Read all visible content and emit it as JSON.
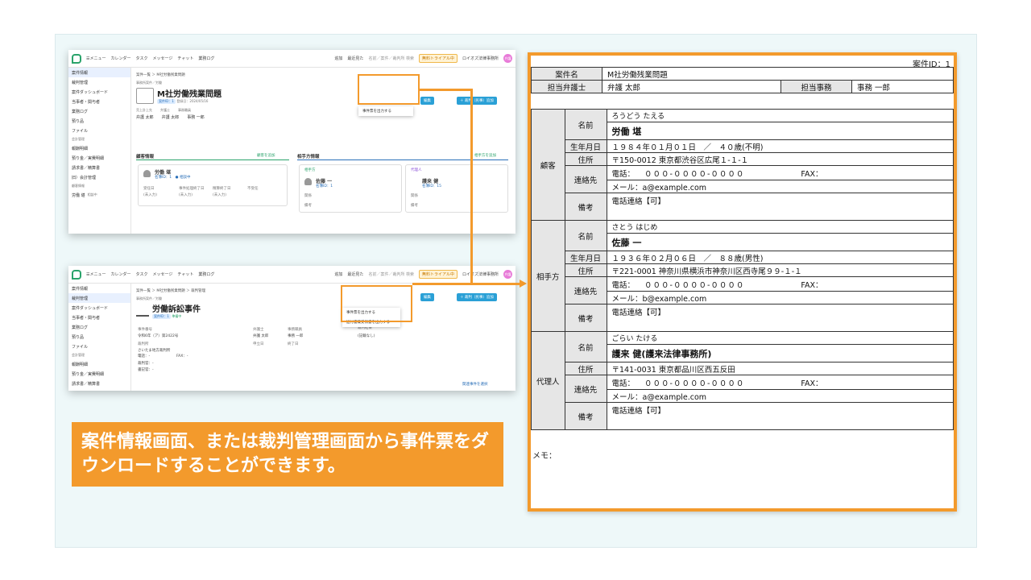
{
  "colors": {
    "accent": "#f39a2c",
    "green": "#2aa36b",
    "blue": "#2aa0d6"
  },
  "app": {
    "menu": "☰メニュー",
    "calendar": "カレンダー",
    "task": "タスク",
    "message": "メッセージ",
    "chat": "チャット",
    "worklog": "業務ログ",
    "add": "追加",
    "recent": "最近見た",
    "search_placeholder": "名前／案件／裁判所 検索",
    "trial": "無料トライアル中",
    "firm": "ロイオズ法律事務所",
    "avatar": "弁護"
  },
  "sidebar1": [
    {
      "label": "案件情報"
    },
    {
      "label": "裁判管理"
    },
    {
      "label": "案件ダッシュボード"
    },
    {
      "label": "当事者・関与者"
    },
    {
      "label": "業務ログ"
    },
    {
      "label": "預り品"
    },
    {
      "label": "ファイル"
    }
  ],
  "sidebar1_accounting": {
    "section": "会計管理",
    "items": [
      "報酬明細",
      "預り金／実費明細",
      "請求書／精算書",
      "旧）会計管理"
    ]
  },
  "sidebar1_client": {
    "section": "顧客情報",
    "name": "労働 堪",
    "status": "相談中"
  },
  "shot1": {
    "crumb": "案件一覧 ＞ M社労働残業問題",
    "category": "事務所案件／労働",
    "title": "M社労働残業問題",
    "case_id": "案件ID：1",
    "created": "登録日：2024/05/16",
    "roles": [
      "売上計上先",
      "弁護士",
      "事務職員"
    ],
    "staff": [
      "弁護 太郎",
      "弁護 太郎",
      "事務 一郎"
    ],
    "edit_btn": "編集",
    "add_btn": "＋ 裁判（民事）追加",
    "menu_item": "事件票を出力する",
    "client_head": "顧客情報",
    "add_client": "顧客を追加",
    "client_name": "労働 堪",
    "client_tags": "名簿ID：1　● 相談中",
    "client_fields": [
      "受任日",
      "事件処理終了日",
      "精算終了日",
      "不受任"
    ],
    "client_values": [
      "(未入力)",
      "(未入力)",
      "(未入力)",
      ""
    ],
    "opp_head": "相手方情報",
    "add_opp": "相手方を追加",
    "opp_label": "相手方",
    "rep_label": "代理人",
    "opp_name": "佐藤 一",
    "opp_id": "名簿ID：1",
    "rep_name": "護来 健",
    "rep_id": "名簿ID：15",
    "relation": "関係",
    "note": "備考"
  },
  "sidebar2": [
    {
      "label": "案件情報"
    },
    {
      "label": "裁判管理"
    },
    {
      "label": "案件ダッシュボード"
    },
    {
      "label": "当事者・関与者"
    },
    {
      "label": "業務ログ"
    },
    {
      "label": "預り品"
    },
    {
      "label": "ファイル"
    }
  ],
  "sidebar2_accounting": {
    "section": "会計管理",
    "items": [
      "報酬明細",
      "預り金／実費明細",
      "請求書／精算書"
    ]
  },
  "shot2": {
    "crumb": "案件一覧 ＞ M社労働残業問題 ＞ 裁判管理",
    "category": "事務所案件／労働",
    "title": "労働訴訟事件",
    "case_id": "案件ID：1",
    "status": "準備中",
    "menu_items": [
      "事件票を出力する",
      "送付書兼受領書を出力する"
    ],
    "case_no_label": "事件番号",
    "case_no": "令和6年（ア）第2422号",
    "court_label": "裁判所",
    "court": "さいたま地方裁判所",
    "phone": "電話：-",
    "fax": "FAX：-",
    "judge": "裁判官：-",
    "clerk": "書記官：-",
    "lawyer_label": "弁護士",
    "lawyer": "弁護 太郎",
    "staff_label": "事務職員",
    "staff": "事務 一郎",
    "result_label": "裁判結果",
    "result": "(記載なし)",
    "date1": "申立日",
    "date2": "終了日",
    "related": "関連事件を選択"
  },
  "caption": "案件情報画面、または裁判管理画面から事件票をダウンロードすることができます。",
  "sheet": {
    "case_id": "案件ID：1",
    "case_name_label": "案件名",
    "case_name": "M社労働残業問題",
    "lawyer_label": "担当弁護士",
    "lawyer": "弁護 太郎",
    "clerk_label": "担当事務",
    "clerk": "事務 一郎",
    "labels": {
      "name": "名前",
      "birth": "生年月日",
      "address": "住所",
      "contact": "連絡先",
      "note": "備考",
      "phone": "電話：",
      "fax": "FAX：",
      "mail": "メール："
    },
    "client": {
      "group": "顧客",
      "kana": "ろうどう たえる",
      "name": "労働 堪",
      "birth": "１９８４年０１月０１日　／　４０歳(不明)",
      "address": "〒150-0012 東京都渋谷区広尾１-１-１",
      "phone": "０００-００００-００００",
      "mail": "a@example.com",
      "note": "電話連絡【可】"
    },
    "opponent": {
      "group": "相手方",
      "kana": "さとう はじめ",
      "name": "佐藤 一",
      "birth": "１９３６年０２月０６日　／　８８歳(男性)",
      "address": "〒221-0001 神奈川県横浜市神奈川区西寺尾９９-１-１",
      "phone": "０００-００００-００００",
      "mail": "b@example.com",
      "note": "電話連絡【可】"
    },
    "agent": {
      "group": "代理人",
      "kana": "ごらい たける",
      "name": "護来 健(護来法律事務所)",
      "address": "〒141-0031 東京都品川区西五反田",
      "phone": "０００-００００-００００",
      "mail": "a@example.com",
      "note": "電話連絡【可】"
    },
    "memo": "メモ："
  }
}
